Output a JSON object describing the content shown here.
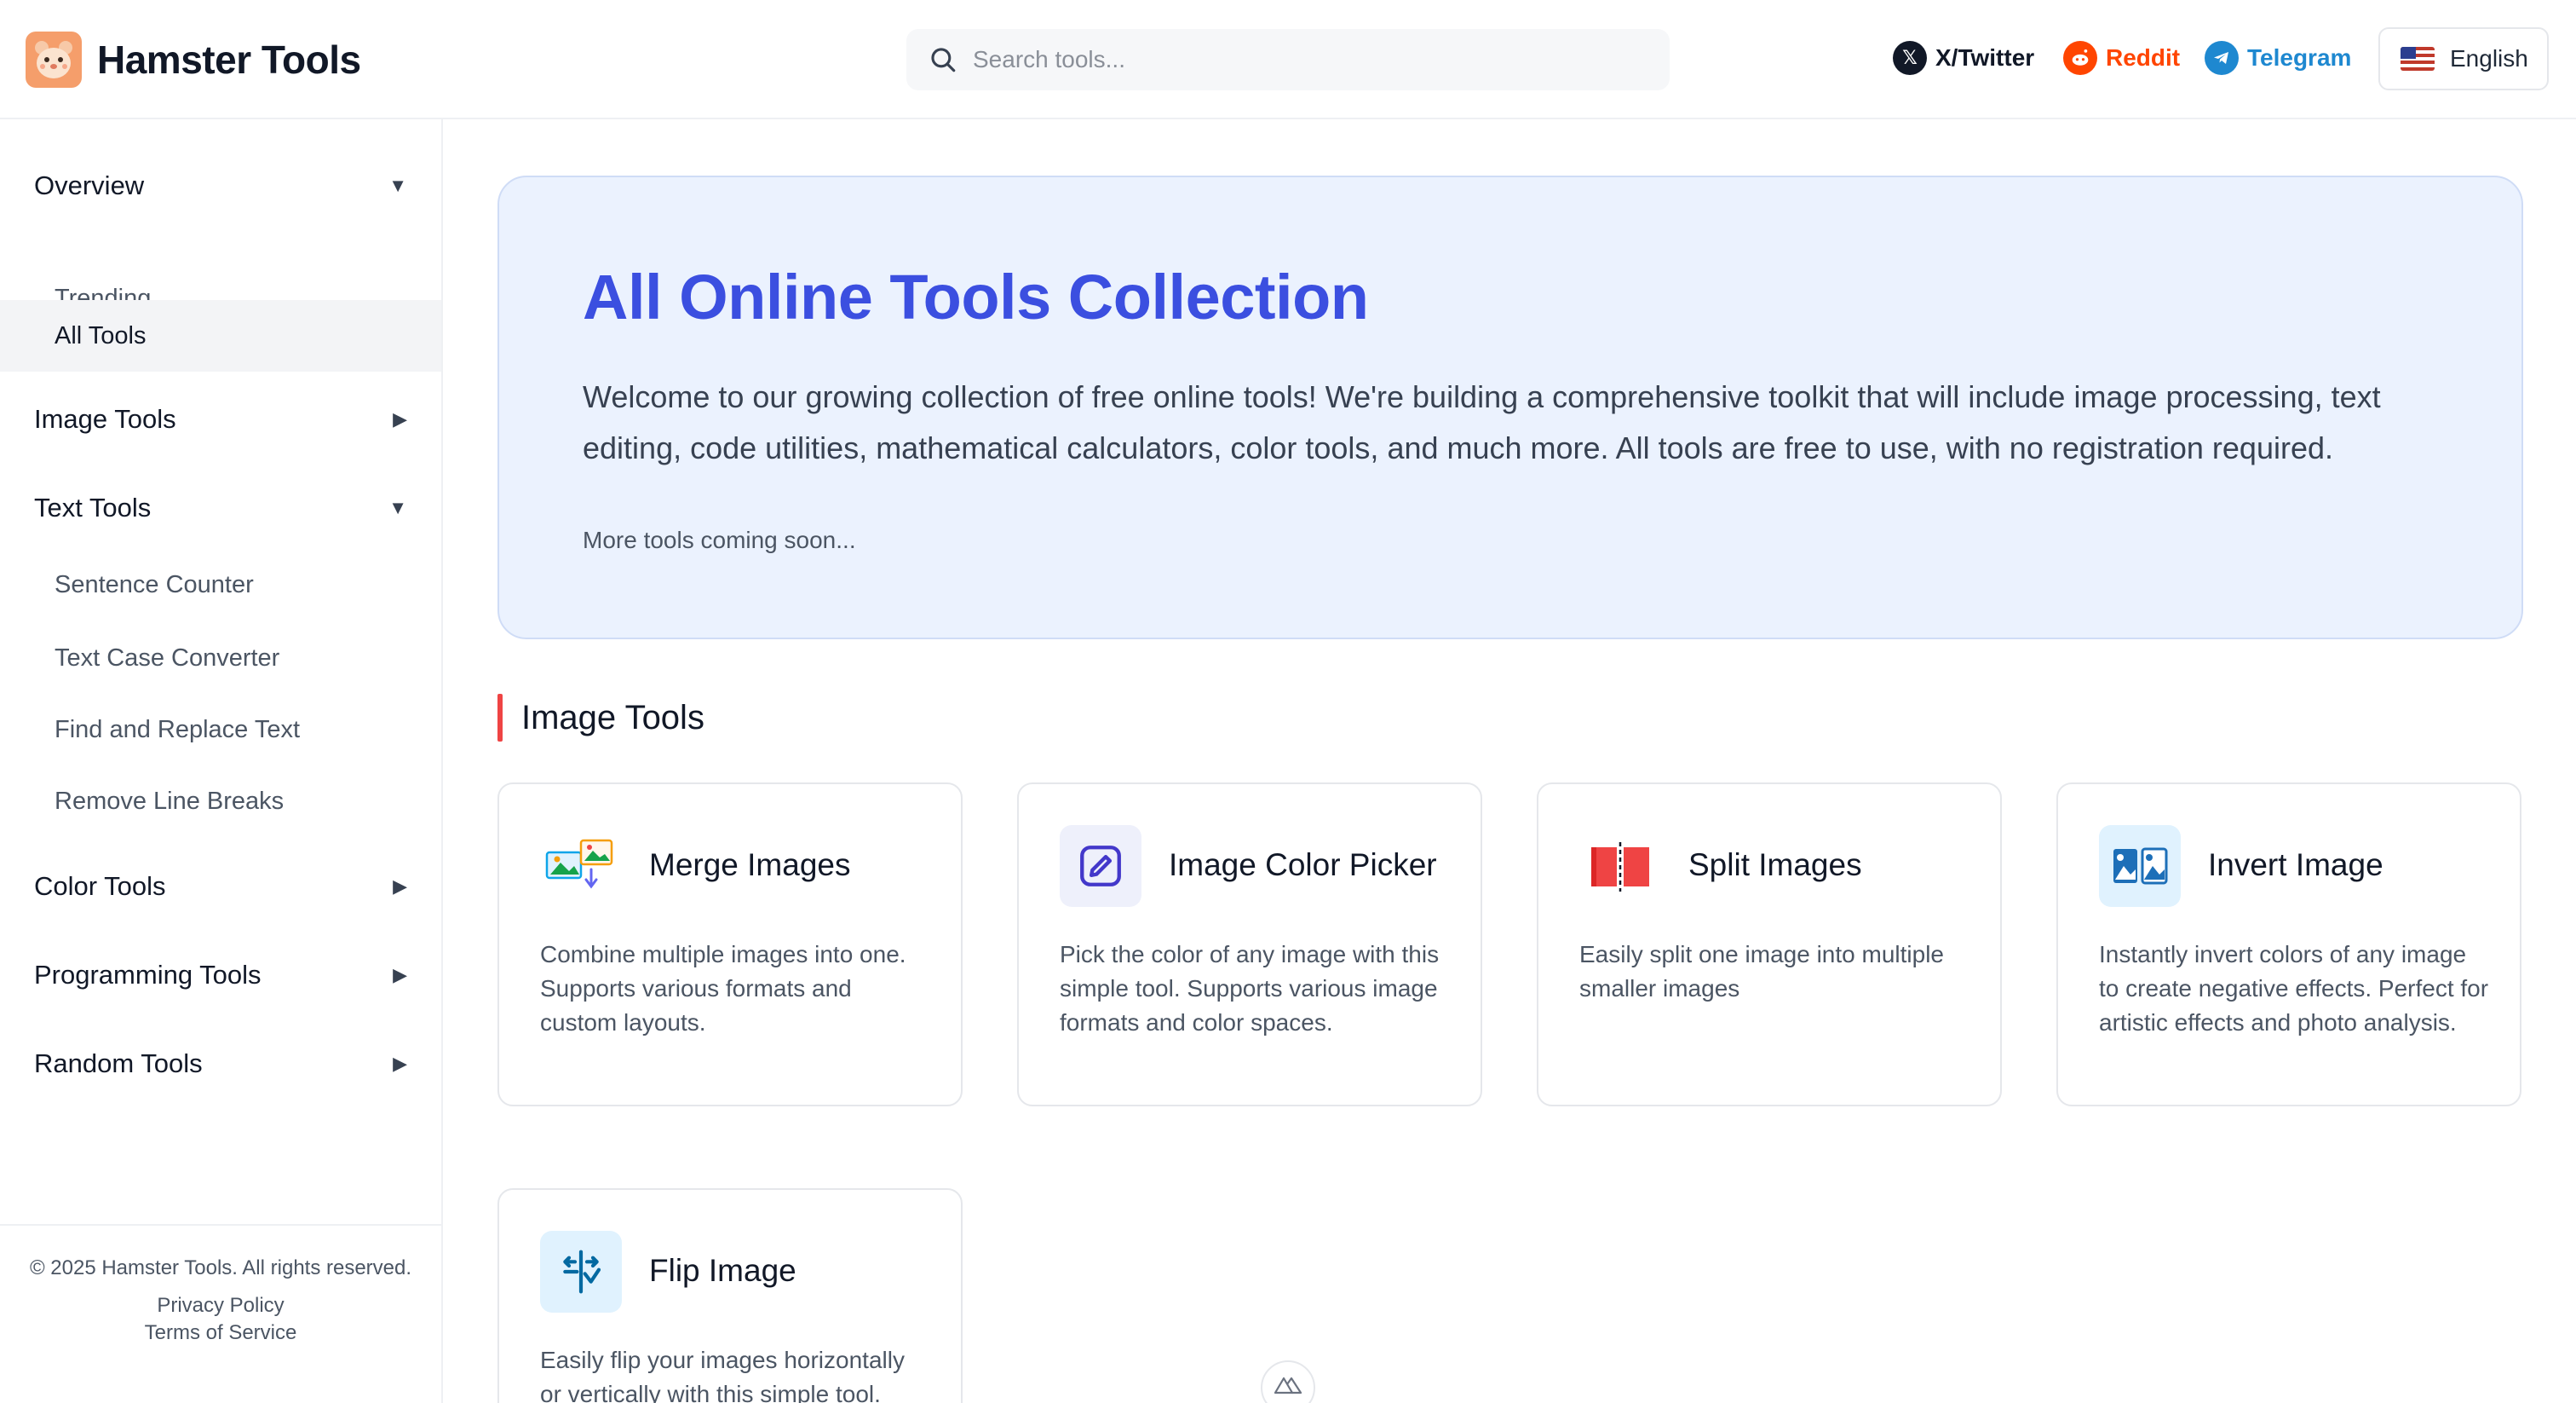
{
  "header": {
    "brand": "Hamster Tools",
    "search_placeholder": "Search tools...",
    "social": [
      {
        "label": "X/Twitter",
        "color": "#111827"
      },
      {
        "label": "Reddit",
        "color": "#ff4500"
      },
      {
        "label": "Telegram",
        "color": "#1e88d0"
      }
    ],
    "language": "English"
  },
  "sidebar": {
    "groups": [
      {
        "label": "Overview",
        "expanded": true,
        "items": [
          "Trending",
          "All Tools"
        ]
      },
      {
        "label": "Image Tools",
        "expanded": false
      },
      {
        "label": "Text Tools",
        "expanded": true,
        "items": [
          "Sentence Counter",
          "Text Case Converter",
          "Find and Replace Text",
          "Remove Line Breaks"
        ]
      },
      {
        "label": "Color Tools",
        "expanded": false
      },
      {
        "label": "Programming Tools",
        "expanded": false
      },
      {
        "label": "Random Tools",
        "expanded": false
      }
    ],
    "active_item": "All Tools",
    "caret_expanded": "▼",
    "caret_collapsed": "▶",
    "footer": {
      "copyright": "© 2025 Hamster Tools. All rights reserved.",
      "privacy": "Privacy Policy",
      "terms": "Terms of Service"
    }
  },
  "hero": {
    "title": "All Online Tools Collection",
    "description": "Welcome to our growing collection of free online tools! We're building a comprehensive toolkit that will include image processing, text editing, code utilities, mathematical calculators, color tools, and much more. All tools are free to use, with no registration required.",
    "note": "More tools coming soon..."
  },
  "section": {
    "title": "Image Tools",
    "accent": "#ef4444"
  },
  "cards": [
    {
      "title": "Merge Images",
      "description": "Combine multiple images into one. Supports various formats and custom layouts.",
      "icon": "merge-images-icon"
    },
    {
      "title": "Image Color Picker",
      "description": "Pick the color of any image with this simple tool. Supports various image formats and color spaces.",
      "icon": "color-picker-icon"
    },
    {
      "title": "Split Images",
      "description": "Easily split one image into multiple smaller images",
      "icon": "split-images-icon"
    },
    {
      "title": "Invert Image",
      "description": "Instantly invert colors of any image to create negative effects. Perfect for artistic effects and photo analysis.",
      "icon": "invert-image-icon"
    },
    {
      "title": "Flip Image",
      "description": "Easily flip your images horizontally or vertically with this simple tool.",
      "icon": "flip-image-icon"
    }
  ]
}
